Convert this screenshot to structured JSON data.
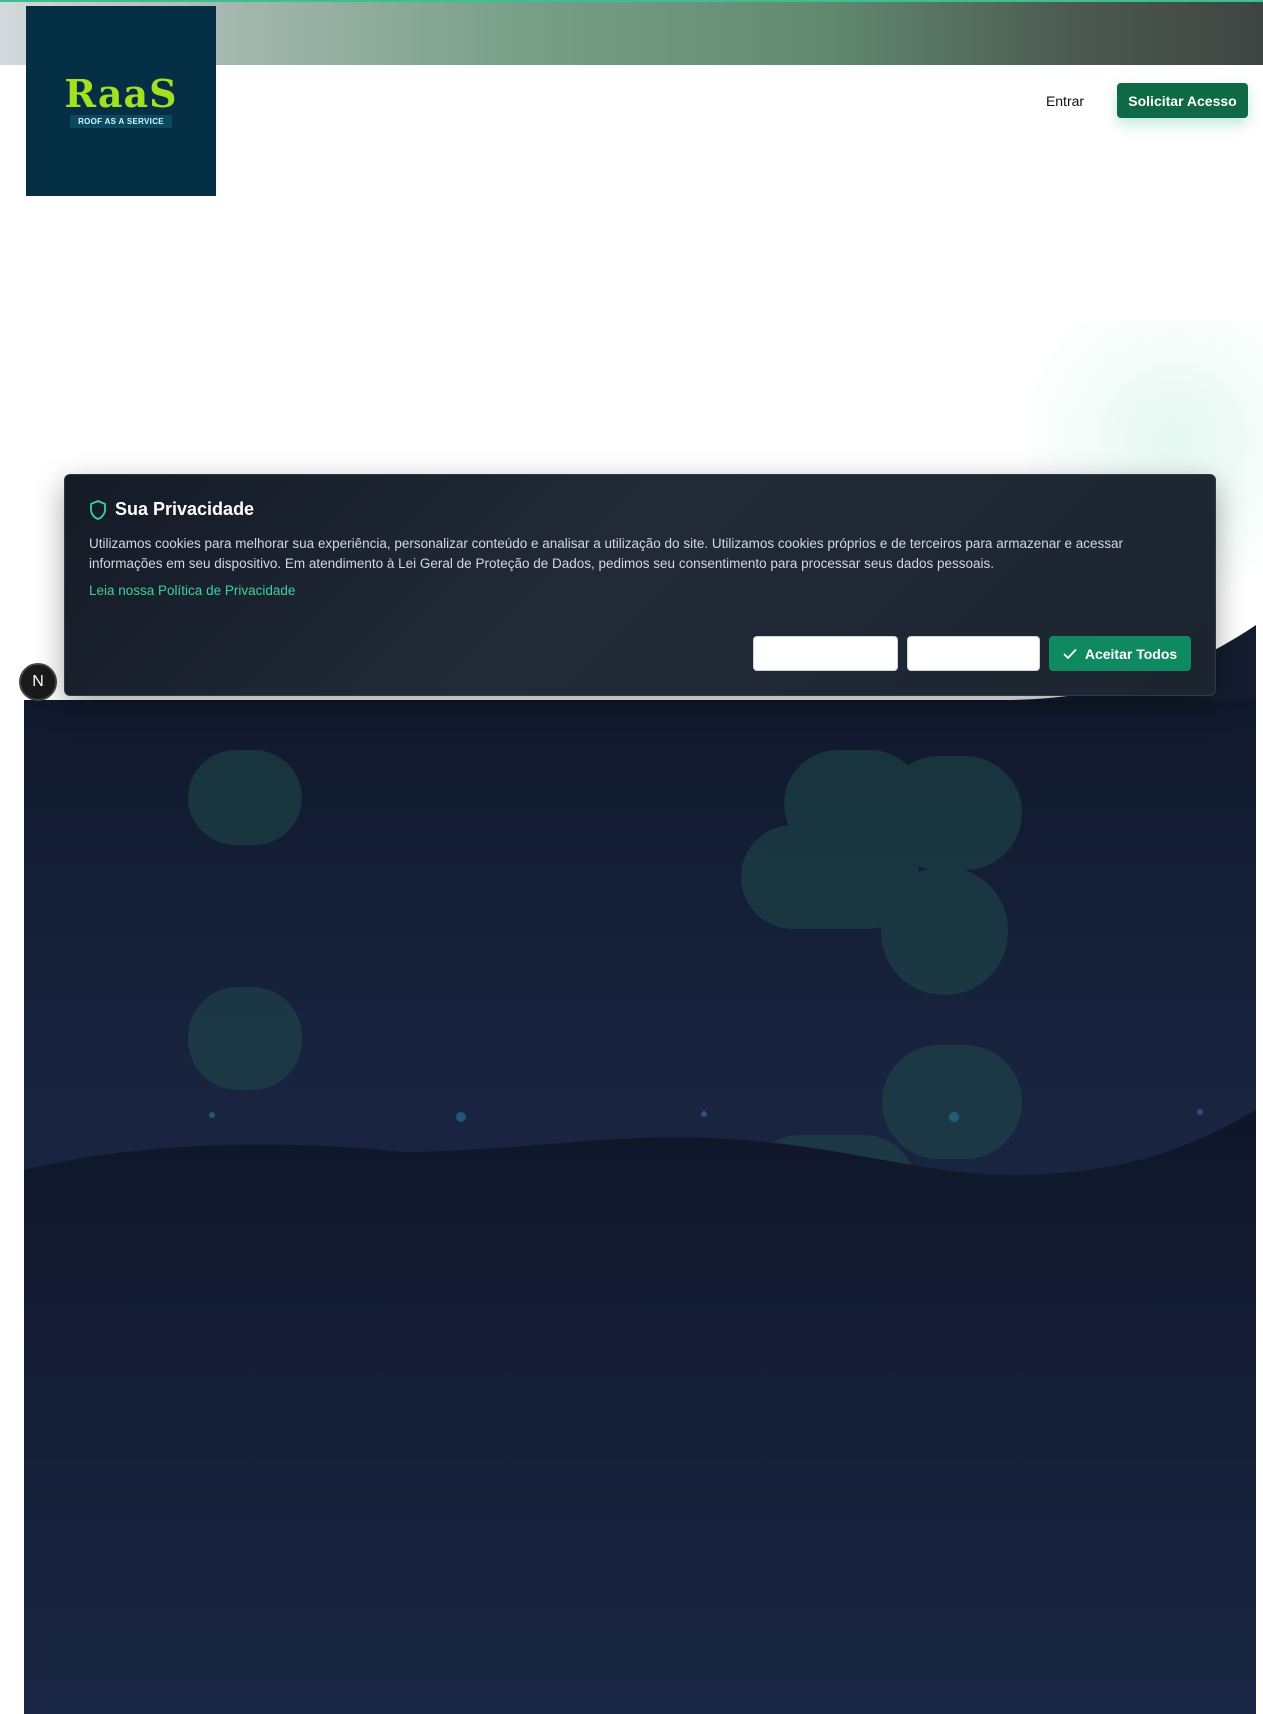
{
  "header": {
    "logo_text": "RaaS",
    "logo_tagline": "ROOF AS A SERVICE",
    "login_label": "Entrar",
    "cta_label": "Solicitar Acesso"
  },
  "cookie_banner": {
    "title": "Sua Privacidade",
    "body": "Utilizamos cookies para melhorar sua experiência, personalizar conteúdo e analisar a utilização do site. Utilizamos cookies próprios e de terceiros para armazenar e acessar informações em seu dispositivo. Em atendimento à Lei Geral de Proteção de Dados, pedimos seu consentimento para processar seus dados pessoais.",
    "policy_link": "Leia nossa Política de Privacidade",
    "accept_label": "Aceitar Todos"
  },
  "dev_badge": {
    "label": "N"
  },
  "colors": {
    "brand_green": "#0f6846",
    "accent_green": "#3fcf9a",
    "hero_dark": "#141c30",
    "logo_bg": "#052f45",
    "logo_text": "#a4e022"
  }
}
